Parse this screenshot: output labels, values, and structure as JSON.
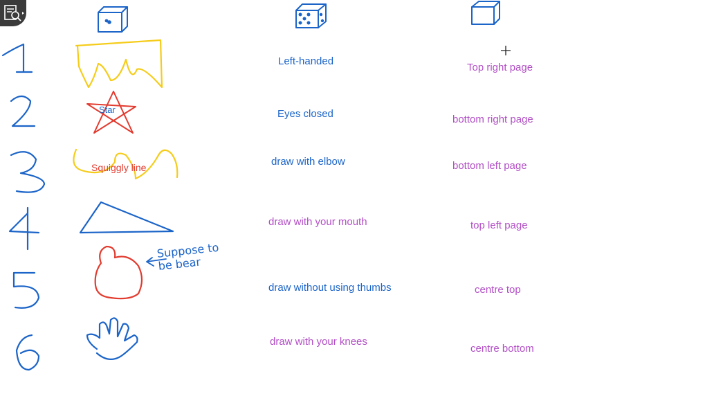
{
  "toolbar": {
    "tool_icon": "search-document-icon"
  },
  "colors": {
    "blue": "#1b64c8",
    "purple": "#b24ec6",
    "red": "#e23b2f",
    "yellow": "#f5cc1a"
  },
  "rows": [
    {
      "number": "1",
      "shape": "Crown",
      "shape_label": "",
      "action": "Left-handed",
      "position": "Top right page"
    },
    {
      "number": "2",
      "shape": "Star",
      "shape_label": "Star",
      "action": "Eyes closed",
      "position": "bottom right page"
    },
    {
      "number": "3",
      "shape": "Squiggly line",
      "shape_label": "Squiggly line",
      "action": "draw with elbow",
      "position": "bottom left page"
    },
    {
      "number": "4",
      "shape": "Triangle",
      "shape_label": "",
      "action": "draw with your mouth",
      "position": "top left page"
    },
    {
      "number": "5",
      "shape": "Duck",
      "shape_label": "",
      "action": "draw without using thumbs",
      "position": "centre top"
    },
    {
      "number": "6",
      "shape": "Hand",
      "shape_label": "",
      "action": "draw with your knees",
      "position": "centre bottom"
    }
  ],
  "annotation": {
    "text": "Suppose to be bear"
  },
  "dice_icons": [
    "die-one-dot-icon",
    "die-multi-dot-icon",
    "blank-cube-icon"
  ]
}
